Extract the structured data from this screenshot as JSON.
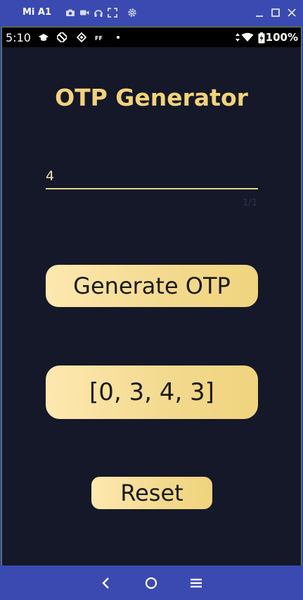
{
  "emulator": {
    "device_name": "Mi A1",
    "toolbar_icons": [
      "camera-icon",
      "video-icon",
      "headphones-icon",
      "fullscreen-icon",
      "settings-icon"
    ],
    "window_controls": [
      "minimize-icon",
      "maximize-icon",
      "close-icon"
    ]
  },
  "status_bar": {
    "time": "5:10",
    "notification_icons": [
      "graduation-cap-icon",
      "forbidden-icon",
      "layers-icon",
      "ff-icon",
      "dot-icon"
    ],
    "battery_percent": "100%"
  },
  "app": {
    "title": "OTP Generator",
    "length_input": {
      "value": "4",
      "counter": "1/1"
    },
    "generate_label": "Generate OTP",
    "otp_result": "[0, 3, 4, 3]",
    "reset_label": "Reset"
  },
  "nav_bar": {
    "buttons": [
      "back-icon",
      "home-icon",
      "menu-icon"
    ]
  },
  "colors": {
    "accent_gold": "#f2d27c",
    "screen_bg": "#141828",
    "frame_blue": "#3b4ab0"
  }
}
